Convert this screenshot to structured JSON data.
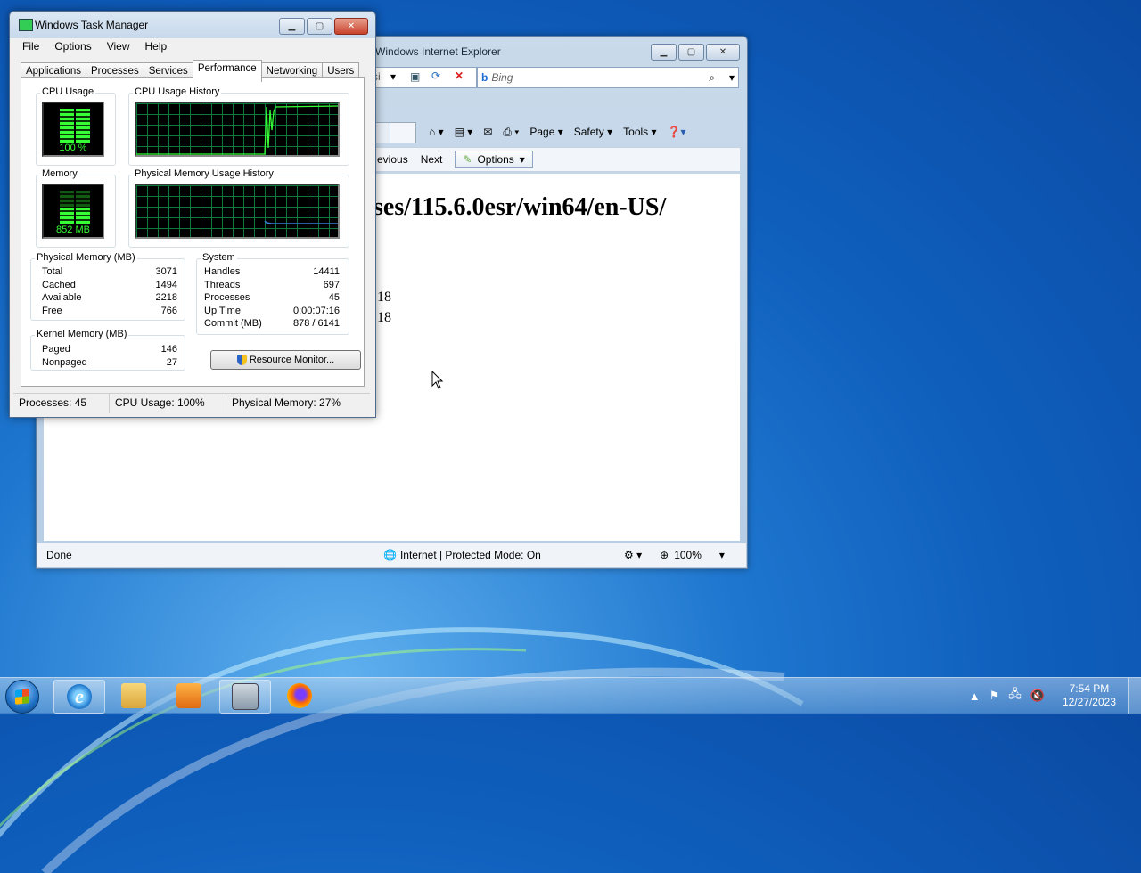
{
  "ie": {
    "title": "Windows Internet Explorer",
    "search_placeholder": "Bing",
    "address_fragment": "si",
    "cmd": {
      "page": "Page",
      "safety": "Safety",
      "tools": "Tools"
    },
    "find": {
      "previous": "evious",
      "next": "Next",
      "options": "Options"
    },
    "tab_fragment": "..",
    "content": {
      "heading": "ses/115.6.0esr/win64/en-US/",
      "line1": "18",
      "line2": "18"
    },
    "status": {
      "done": "Done",
      "zone": "Internet | Protected Mode: On",
      "zoom": "100%"
    }
  },
  "taskmgr": {
    "title": "Windows Task Manager",
    "menu": [
      "File",
      "Options",
      "View",
      "Help"
    ],
    "tabs": [
      "Applications",
      "Processes",
      "Services",
      "Performance",
      "Networking",
      "Users"
    ],
    "active_tab": "Performance",
    "cpu": {
      "label": "CPU Usage",
      "value": "100 %",
      "history_label": "CPU Usage History",
      "percent": 100
    },
    "memory": {
      "label": "Memory",
      "value": "852 MB",
      "history_label": "Physical Memory Usage History"
    },
    "physical": {
      "label": "Physical Memory (MB)",
      "rows": [
        {
          "name": "Total",
          "value": "3071"
        },
        {
          "name": "Cached",
          "value": "1494"
        },
        {
          "name": "Available",
          "value": "2218"
        },
        {
          "name": "Free",
          "value": "766"
        }
      ]
    },
    "kernel": {
      "label": "Kernel Memory (MB)",
      "rows": [
        {
          "name": "Paged",
          "value": "146"
        },
        {
          "name": "Nonpaged",
          "value": "27"
        }
      ]
    },
    "system": {
      "label": "System",
      "rows": [
        {
          "name": "Handles",
          "value": "14411"
        },
        {
          "name": "Threads",
          "value": "697"
        },
        {
          "name": "Processes",
          "value": "45"
        },
        {
          "name": "Up Time",
          "value": "0:00:07:16"
        },
        {
          "name": "Commit (MB)",
          "value": "878 / 6141"
        }
      ]
    },
    "resource_monitor": "Resource Monitor...",
    "status": {
      "processes": "Processes: 45",
      "cpu": "CPU Usage: 100%",
      "memory": "Physical Memory: 27%"
    }
  },
  "taskbar": {
    "clock_time": "7:54 PM",
    "clock_date": "12/27/2023"
  },
  "colors": {
    "meter_green": "#36ff36",
    "grid_green": "#0b7a3b",
    "mem_line": "#3a7bd5"
  }
}
